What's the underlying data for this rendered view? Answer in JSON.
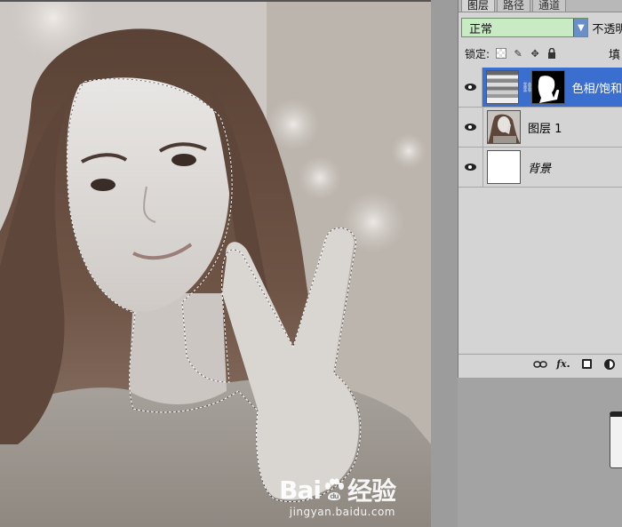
{
  "panel": {
    "tabs": [
      "图层",
      "路径",
      "通道"
    ],
    "blend_mode": "正常",
    "opacity_label": "不透明",
    "lock_label": "锁定:",
    "fill_label": "填"
  },
  "layers": [
    {
      "name": "色相/饱和",
      "selected": true,
      "type": "adjustment"
    },
    {
      "name": "图层 1",
      "selected": false,
      "type": "photo"
    },
    {
      "name": "背景",
      "selected": false,
      "type": "background"
    }
  ],
  "watermark": {
    "brand_left": "Bai",
    "brand_right": "经验",
    "url": "jingyan.baidu.com"
  },
  "icons": {
    "visibility": "eye-icon",
    "link": "link-icon",
    "fx": "fx-icon",
    "mask": "add-mask-icon",
    "adjustment": "adjustment-layer-icon"
  },
  "colors": {
    "selected_layer": "#3a6fd0",
    "blend_select_bg": "#c9ebc4"
  }
}
